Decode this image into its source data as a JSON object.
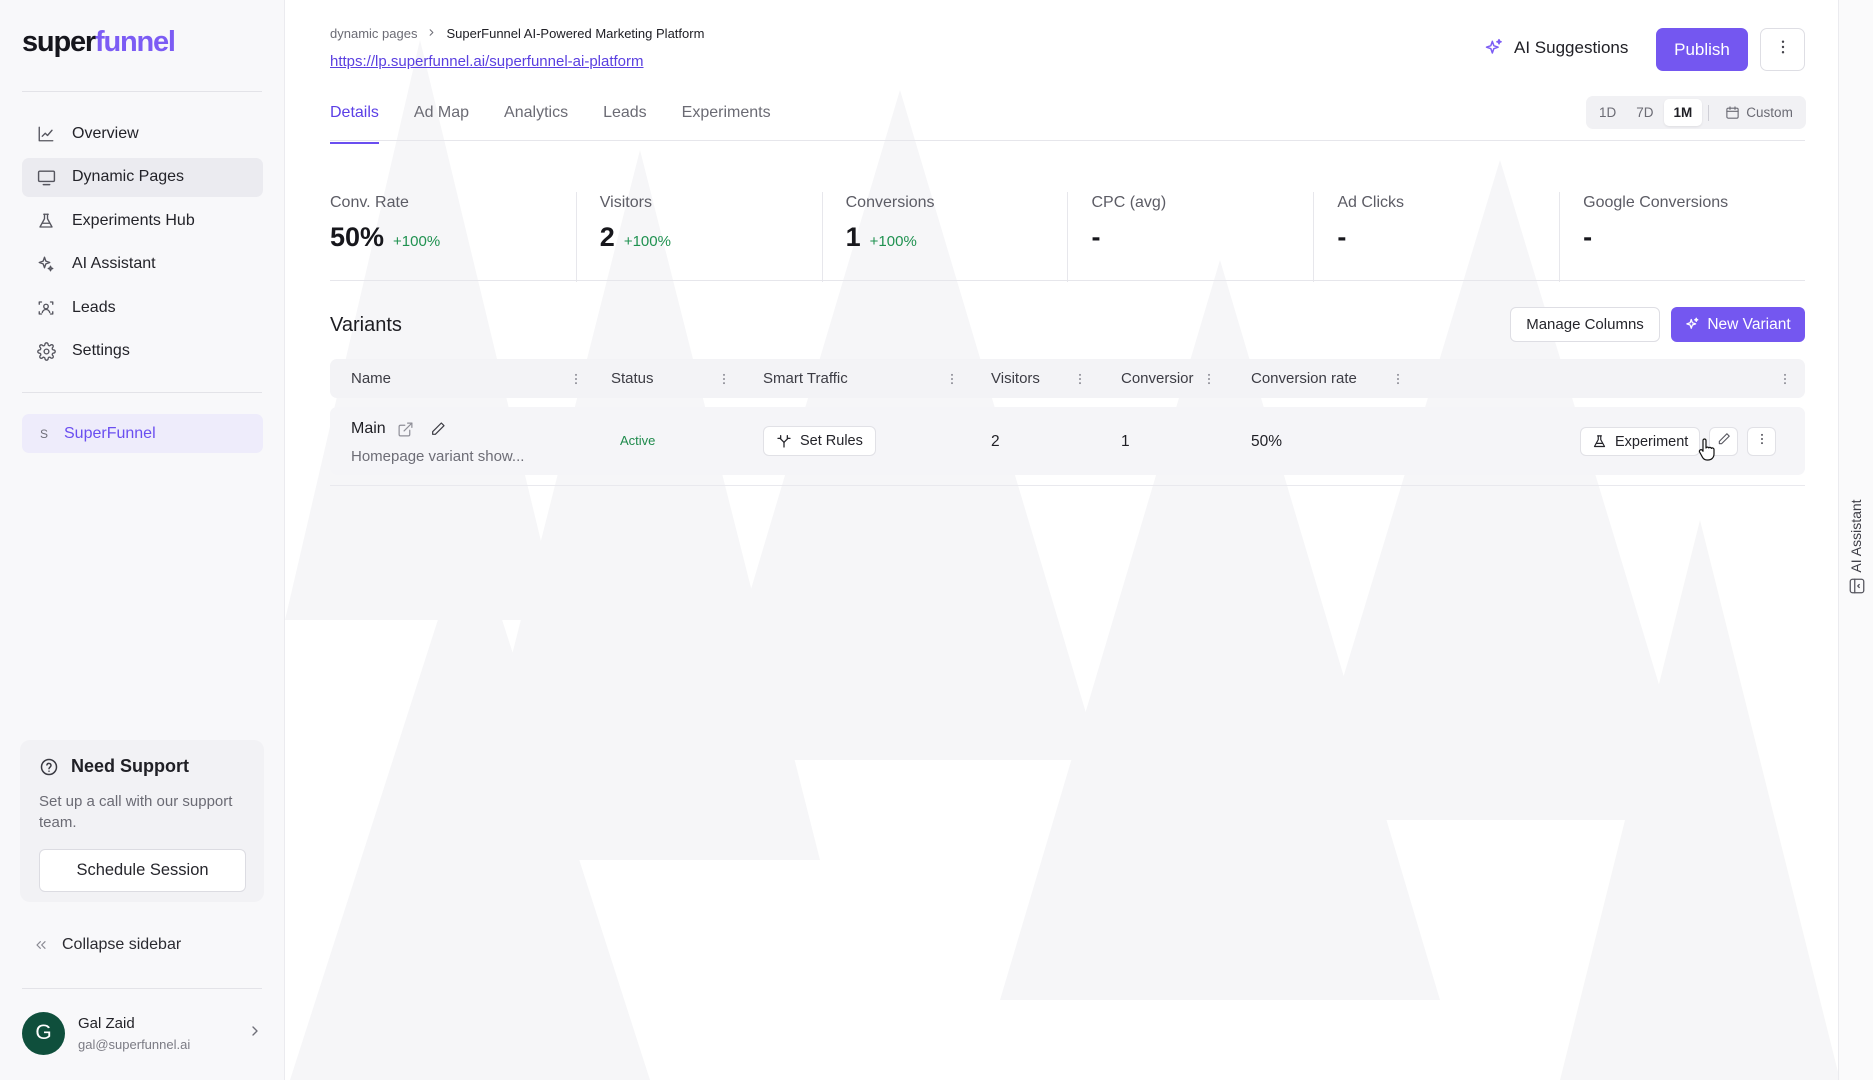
{
  "brand": {
    "logo_text": "superfunnel",
    "accent_color": "#7457f0"
  },
  "sidebar": {
    "items": [
      {
        "label": "Overview",
        "icon": "chart-line-icon",
        "active": false
      },
      {
        "label": "Dynamic Pages",
        "icon": "monitor-icon",
        "active": true
      },
      {
        "label": "Experiments Hub",
        "icon": "flask-icon",
        "active": false
      },
      {
        "label": "AI Assistant",
        "icon": "sparkles-icon",
        "active": false
      },
      {
        "label": "Leads",
        "icon": "user-scan-icon",
        "active": false
      },
      {
        "label": "Settings",
        "icon": "gear-icon",
        "active": false
      }
    ],
    "workspace": {
      "letter": "S",
      "name": "SuperFunnel"
    },
    "support": {
      "title": "Need Support",
      "text": "Set up a call with our support team.",
      "button": "Schedule Session"
    },
    "collapse_label": "Collapse sidebar",
    "user": {
      "initial": "G",
      "name": "Gal Zaid",
      "email": "gal@superfunnel.ai"
    }
  },
  "header": {
    "breadcrumb": {
      "parent": "dynamic pages",
      "current": "SuperFunnel AI-Powered Marketing Platform"
    },
    "url": "https://lp.superfunnel.ai/superfunnel-ai-platform",
    "ai_suggestions": "AI Suggestions",
    "publish": "Publish"
  },
  "tabs": [
    {
      "label": "Details",
      "active": true
    },
    {
      "label": "Ad Map",
      "active": false
    },
    {
      "label": "Analytics",
      "active": false
    },
    {
      "label": "Leads",
      "active": false
    },
    {
      "label": "Experiments",
      "active": false
    }
  ],
  "range": {
    "options": [
      "1D",
      "7D",
      "1M"
    ],
    "selected": "1M",
    "custom": "Custom"
  },
  "stats": [
    {
      "label": "Conv. Rate",
      "value": "50%",
      "delta": "+100%"
    },
    {
      "label": "Visitors",
      "value": "2",
      "delta": "+100%"
    },
    {
      "label": "Conversions",
      "value": "1",
      "delta": "+100%"
    },
    {
      "label": "CPC (avg)",
      "value": "-",
      "delta": ""
    },
    {
      "label": "Ad Clicks",
      "value": "-",
      "delta": ""
    },
    {
      "label": "Google Conversions",
      "value": "-",
      "delta": ""
    }
  ],
  "variants": {
    "title": "Variants",
    "manage_columns": "Manage Columns",
    "new_variant": "New Variant",
    "columns": [
      "Name",
      "Status",
      "Smart Traffic",
      "Visitors",
      "Conversior",
      "Conversion rate"
    ],
    "rows": [
      {
        "name": "Main",
        "description": "Homepage variant show...",
        "status": "Active",
        "smart_traffic": "Set Rules",
        "visitors": "2",
        "conversions": "1",
        "conversion_rate": "50%",
        "experiment": "Experiment"
      }
    ]
  },
  "ai_rail": {
    "label": "AI Assistant"
  }
}
